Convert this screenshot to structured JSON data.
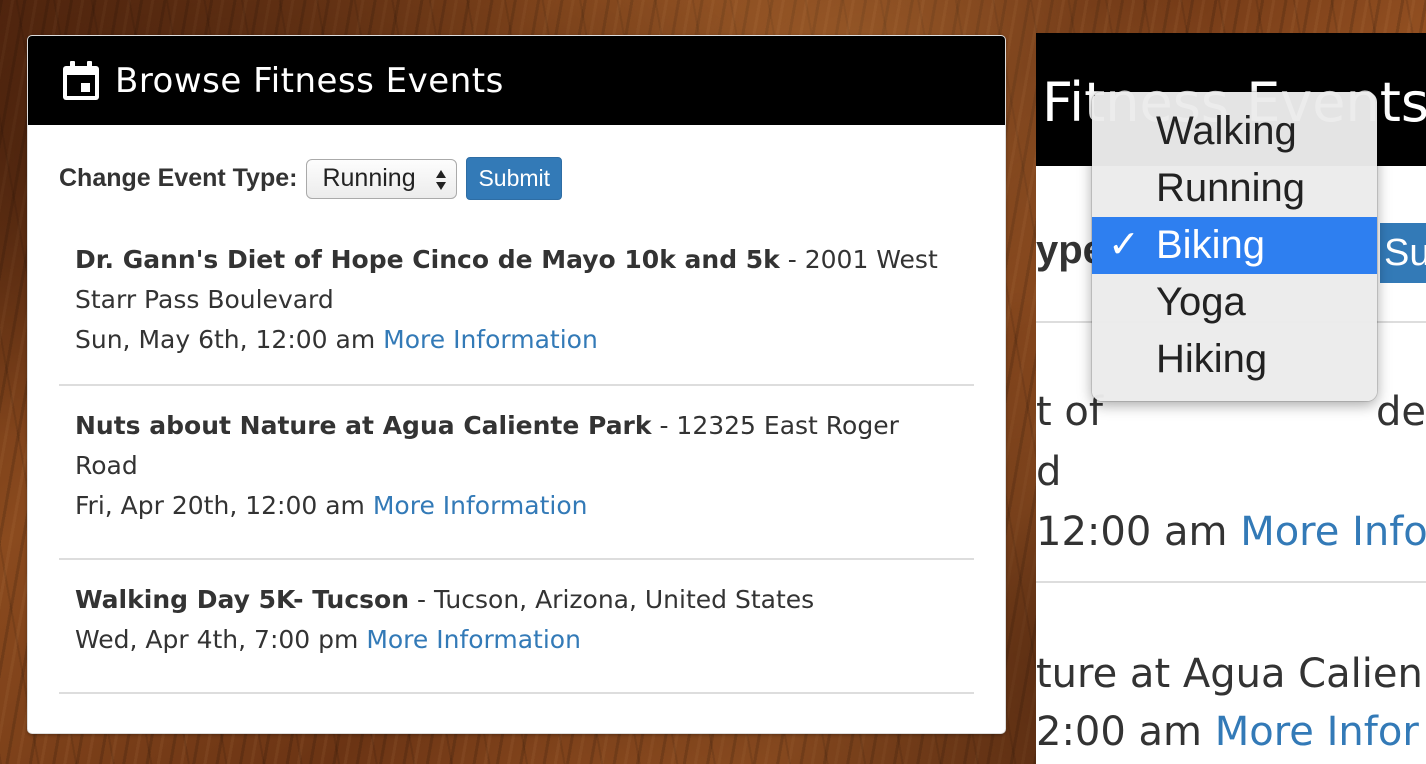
{
  "panel": {
    "title": "Browse Fitness Events",
    "filter_label": "Change Event Type:",
    "selected_type": "Running",
    "submit_label": "Submit"
  },
  "events": [
    {
      "name": "Dr. Gann's Diet of Hope Cinco de Mayo 10k and 5k",
      "location": " - 2001 West Starr Pass Boulevard",
      "date": "Sun, May 6th, 12:00 am",
      "link": "More Information"
    },
    {
      "name": "Nuts about Nature at Agua Caliente Park",
      "location": " - 12325 East Roger Road",
      "date": "Fri, Apr 20th, 12:00 am",
      "link": "More Information"
    },
    {
      "name": "Walking Day 5K- Tucson",
      "location": " - Tucson, Arizona, United States",
      "date": "Wed, Apr 4th, 7:00 pm",
      "link": "More Information"
    }
  ],
  "zoom": {
    "title": "Fitness Events",
    "type_fragment": "ype",
    "submit_fragment": "Su",
    "row1_text": "t of",
    "row1_tail": "de",
    "row2_text": "d",
    "row3_time": "12:00 am ",
    "row3_link": "More Info",
    "row4_text": "ture at Agua Calien",
    "row5_time": "2:00 am ",
    "row5_link": "More Infor"
  },
  "dropdown": {
    "options": [
      "Walking",
      "Running",
      "Biking",
      "Yoga",
      "Hiking"
    ],
    "selected_index": 2,
    "check_glyph": "✓"
  },
  "colors": {
    "header_bg": "#000000",
    "link": "#337ab7",
    "button": "#337ab7",
    "dropdown_highlight": "#2e7ff0"
  }
}
